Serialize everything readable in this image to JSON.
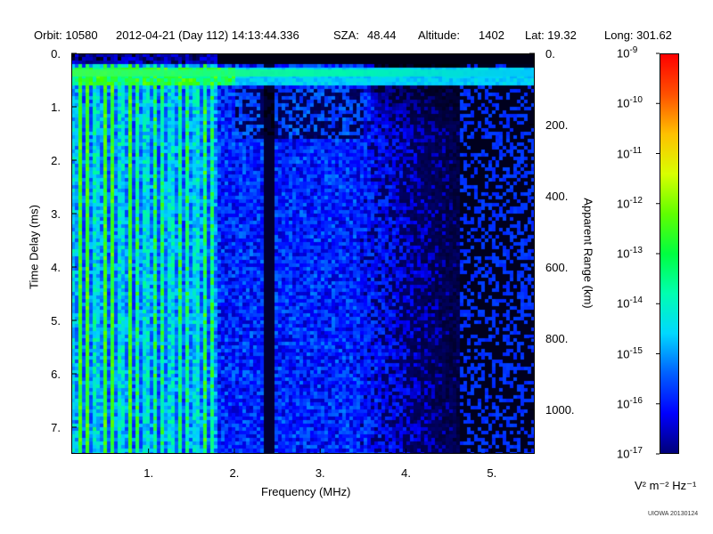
{
  "header": {
    "orbit": "Orbit: 10580",
    "datetime": "2012-04-21 (Day 112) 14:13:44.336",
    "sza_label": "SZA:",
    "sza_value": "48.44",
    "altitude_label": "Altitude:",
    "altitude_value": "1402",
    "lat": "Lat:  19.32",
    "long": "Long: 301.62"
  },
  "chart_data": {
    "type": "heatmap",
    "title": "",
    "xlabel": "Frequency (MHz)",
    "ylabel": "Time Delay (ms)",
    "y2label": "Apparent Range (km)",
    "xlim": [
      0.1,
      5.5
    ],
    "ylim": [
      0,
      7.5
    ],
    "y2lim": [
      0,
      1125
    ],
    "x_ticks": [
      {
        "value": 1,
        "label": "1."
      },
      {
        "value": 2,
        "label": "2."
      },
      {
        "value": 3,
        "label": "3."
      },
      {
        "value": 4,
        "label": "4."
      },
      {
        "value": 5,
        "label": "5."
      }
    ],
    "y_ticks": [
      {
        "value": 0,
        "label": "0."
      },
      {
        "value": 1,
        "label": "1."
      },
      {
        "value": 2,
        "label": "2."
      },
      {
        "value": 3,
        "label": "3."
      },
      {
        "value": 4,
        "label": "4."
      },
      {
        "value": 5,
        "label": "5."
      },
      {
        "value": 6,
        "label": "6."
      },
      {
        "value": 7,
        "label": "7."
      }
    ],
    "y2_ticks": [
      {
        "value": 0,
        "label": "0."
      },
      {
        "value": 200,
        "label": "200."
      },
      {
        "value": 400,
        "label": "400."
      },
      {
        "value": 600,
        "label": "600."
      },
      {
        "value": 800,
        "label": "800."
      },
      {
        "value": 1000,
        "label": "1000."
      }
    ],
    "colorbar": {
      "scale": "log",
      "range": [
        -17,
        -9
      ],
      "ticks": [
        {
          "exp": -17,
          "label": "10",
          "sup": "-17"
        },
        {
          "exp": -16,
          "label": "10",
          "sup": "-16"
        },
        {
          "exp": -15,
          "label": "10",
          "sup": "-15"
        },
        {
          "exp": -14,
          "label": "10",
          "sup": "-14"
        },
        {
          "exp": -13,
          "label": "10",
          "sup": "-13"
        },
        {
          "exp": -12,
          "label": "10",
          "sup": "-12"
        },
        {
          "exp": -11,
          "label": "10",
          "sup": "-11"
        },
        {
          "exp": -10,
          "label": "10",
          "sup": "-10"
        },
        {
          "exp": -9,
          "label": "10",
          "sup": "-9"
        }
      ],
      "unit": "V² m⁻² Hz⁻¹"
    },
    "features": {
      "surface_echo_delay_ms": 0.3,
      "strong_low_freq_below_mhz": 1.8,
      "noise_cutoff_mhz": 4.6,
      "dark_gap_mhz": 2.4
    }
  },
  "colors": {
    "background": "#000000",
    "noise_blue": "#0000ff",
    "bright_cyan": "#00c8ff",
    "green": "#00ff40"
  },
  "footer": "UIOWA 20130124"
}
